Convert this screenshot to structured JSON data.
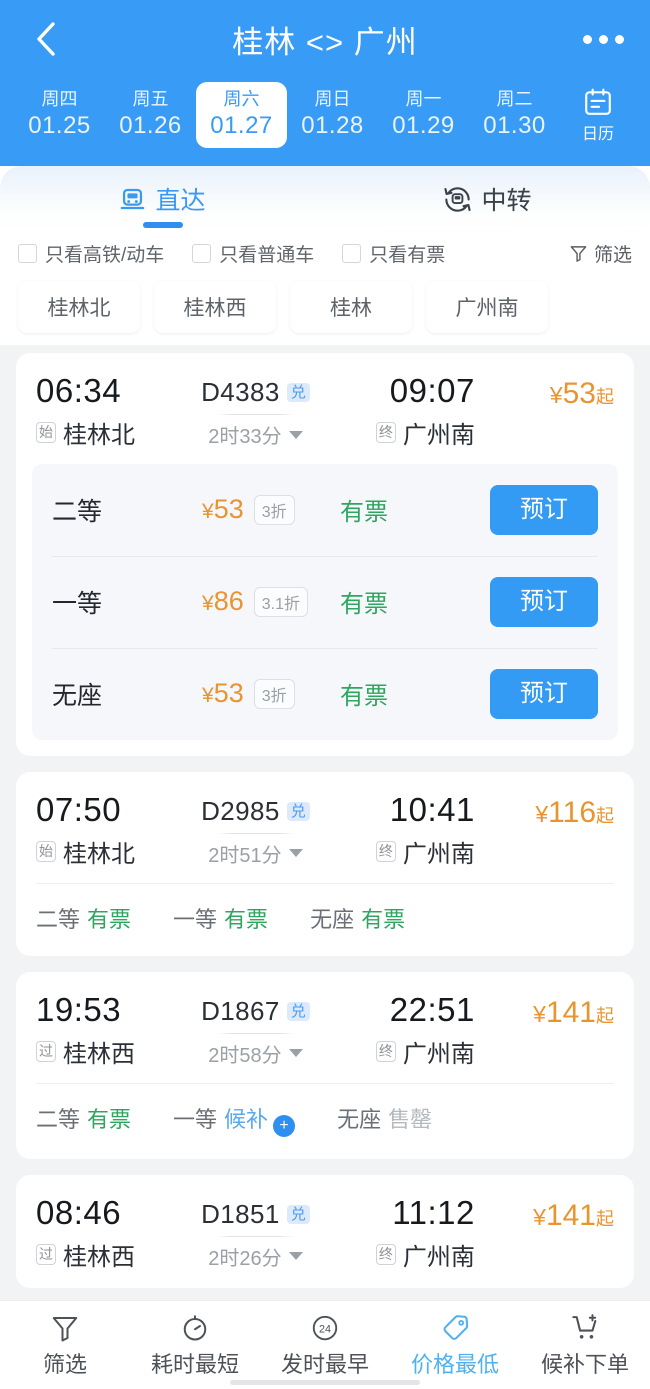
{
  "header": {
    "title": "桂林 <> 广州",
    "back_icon": "chevron-left-icon",
    "more_icon": "more-horizontal-icon",
    "dates": [
      {
        "weekday": "周四",
        "date": "01.25",
        "active": false
      },
      {
        "weekday": "周五",
        "date": "01.26",
        "active": false
      },
      {
        "weekday": "周六",
        "date": "01.27",
        "active": true
      },
      {
        "weekday": "周日",
        "date": "01.28",
        "active": false
      },
      {
        "weekday": "周一",
        "date": "01.29",
        "active": false
      },
      {
        "weekday": "周二",
        "date": "01.30",
        "active": false
      }
    ],
    "calendar": {
      "label": "日历",
      "icon": "calendar-icon"
    }
  },
  "tabs": [
    {
      "label": "直达",
      "icon": "train-icon",
      "active": true
    },
    {
      "label": "中转",
      "icon": "transfer-train-icon",
      "active": false
    }
  ],
  "filters": {
    "checkboxes": [
      {
        "label": "只看高铁/动车",
        "checked": false
      },
      {
        "label": "只看普通车",
        "checked": false
      },
      {
        "label": "只看有票",
        "checked": false
      }
    ],
    "filter_button": {
      "label": "筛选",
      "icon": "funnel-icon"
    },
    "station_chips": [
      "桂林北",
      "桂林西",
      "桂林",
      "广州南"
    ]
  },
  "trains": [
    {
      "depart_time": "06:34",
      "depart_tag": "始",
      "depart_station": "桂林北",
      "train_no": "D4383",
      "exchange_badge": "兑",
      "duration": "2时33分",
      "arrive_time": "09:07",
      "arrive_tag": "终",
      "arrive_station": "广州南",
      "price_currency": "¥",
      "price": "53",
      "price_suffix": "起",
      "expanded": true,
      "seats_detail": [
        {
          "name": "二等",
          "currency": "¥",
          "price": "53",
          "discount": "3折",
          "status": "有票",
          "book_label": "预订"
        },
        {
          "name": "一等",
          "currency": "¥",
          "price": "86",
          "discount": "3.1折",
          "status": "有票",
          "book_label": "预订"
        },
        {
          "name": "无座",
          "currency": "¥",
          "price": "53",
          "discount": "3折",
          "status": "有票",
          "book_label": "预订"
        }
      ],
      "seats_summary": []
    },
    {
      "depart_time": "07:50",
      "depart_tag": "始",
      "depart_station": "桂林北",
      "train_no": "D2985",
      "exchange_badge": "兑",
      "duration": "2时51分",
      "arrive_time": "10:41",
      "arrive_tag": "终",
      "arrive_station": "广州南",
      "price_currency": "¥",
      "price": "116",
      "price_suffix": "起",
      "expanded": false,
      "seats_detail": [],
      "seats_summary": [
        {
          "name": "二等",
          "status": "有票",
          "state": "ok"
        },
        {
          "name": "一等",
          "status": "有票",
          "state": "ok"
        },
        {
          "name": "无座",
          "status": "有票",
          "state": "ok"
        }
      ]
    },
    {
      "depart_time": "19:53",
      "depart_tag": "过",
      "depart_station": "桂林西",
      "train_no": "D1867",
      "exchange_badge": "兑",
      "duration": "2时58分",
      "arrive_time": "22:51",
      "arrive_tag": "终",
      "arrive_station": "广州南",
      "price_currency": "¥",
      "price": "141",
      "price_suffix": "起",
      "expanded": false,
      "seats_detail": [],
      "seats_summary": [
        {
          "name": "二等",
          "status": "有票",
          "state": "ok"
        },
        {
          "name": "一等",
          "status": "候补",
          "state": "wait",
          "plus": "+"
        },
        {
          "name": "无座",
          "status": "售罄",
          "state": "sold"
        }
      ]
    },
    {
      "depart_time": "08:46",
      "depart_tag": "过",
      "depart_station": "桂林西",
      "train_no": "D1851",
      "exchange_badge": "兑",
      "duration": "2时26分",
      "arrive_time": "11:12",
      "arrive_tag": "终",
      "arrive_station": "广州南",
      "price_currency": "¥",
      "price": "141",
      "price_suffix": "起",
      "expanded": false,
      "seats_detail": [],
      "seats_summary": []
    }
  ],
  "bottom_nav": [
    {
      "label": "筛选",
      "icon": "funnel-icon",
      "active": false
    },
    {
      "label": "耗时最短",
      "icon": "stopwatch-icon",
      "active": false
    },
    {
      "label": "发时最早",
      "icon": "clock-24-icon",
      "active": false,
      "badge": "24"
    },
    {
      "label": "价格最低",
      "icon": "price-tag-icon",
      "active": true
    },
    {
      "label": "候补下单",
      "icon": "cart-plus-icon",
      "active": false
    }
  ],
  "colors": {
    "brand_blue": "#389bf5",
    "price_orange": "#e9942f",
    "status_green": "#2fa65f",
    "status_gray": "#b4b9bf",
    "waitlist_blue": "#5aa9ec"
  }
}
